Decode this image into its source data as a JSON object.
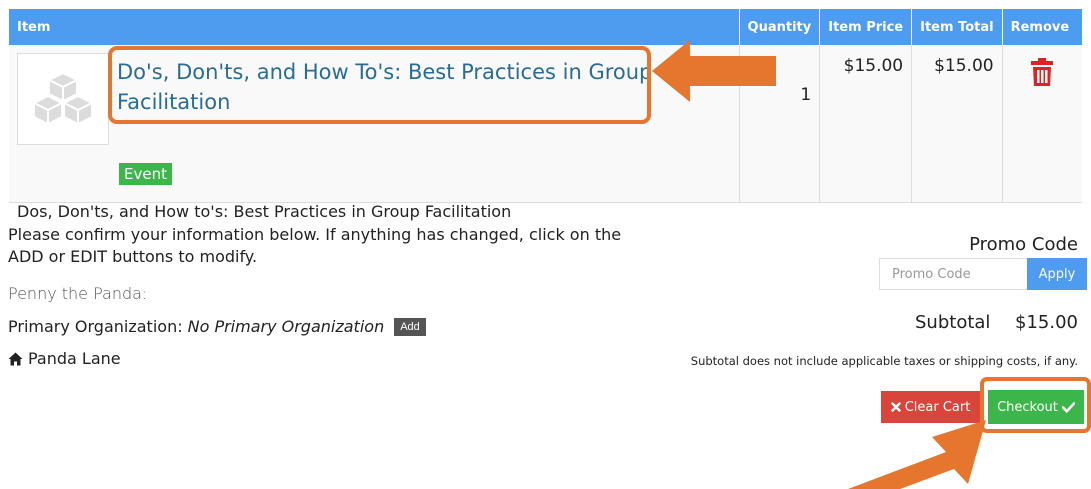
{
  "table": {
    "headers": {
      "item": "Item",
      "quantity": "Quantity",
      "item_price": "Item Price",
      "item_total": "Item Total",
      "remove": "Remove"
    },
    "rows": [
      {
        "title": "Do's, Don'ts, and How To's: Best Practices in Group Facilitation",
        "badge": "Event",
        "description": "Dos, Don'ts, and How to's: Best Practices in Group Facilitation",
        "quantity": "1",
        "price": "$15.00",
        "total": "$15.00",
        "thumbnail_icon": "cubes-placeholder-icon",
        "remove_icon": "trash-icon"
      }
    ]
  },
  "info": {
    "confirm_text": "Please confirm your information below. If anything has changed, click on the ADD or EDIT buttons to modify.",
    "person_name": "Penny the Panda:",
    "org_label": "Primary Organization:",
    "org_value": "No Primary Organization",
    "add_label": "Add",
    "address": "Panda Lane",
    "address_icon": "home-icon"
  },
  "summary": {
    "promo_label": "Promo Code",
    "promo_placeholder": "Promo Code",
    "apply_label": "Apply",
    "subtotal_label": "Subtotal",
    "subtotal_value": "$15.00",
    "subtotal_note": "Subtotal does not include applicable taxes or shipping costs, if any.",
    "clear_label": "Clear Cart",
    "checkout_label": "Checkout"
  },
  "colors": {
    "header_blue": "#4d9cf0",
    "success_green": "#3cb64a",
    "danger_red": "#d9453b",
    "annotation_orange": "#e6762e",
    "link_blue": "#2a6c92"
  }
}
